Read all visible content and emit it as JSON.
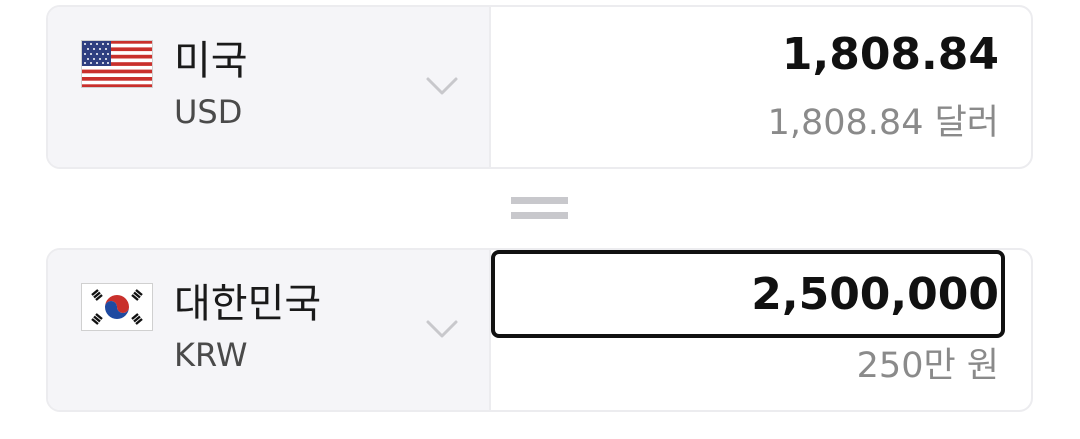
{
  "from": {
    "country": "미국",
    "code": "USD",
    "flag_icon": "us-flag-icon",
    "amount": "1,808.84",
    "amount_text": "1,808.84 달러"
  },
  "equals_icon": "equals-icon",
  "to": {
    "country": "대한민국",
    "code": "KRW",
    "flag_icon": "kr-flag-icon",
    "amount": "2,500,000",
    "amount_text": "250만 원"
  },
  "colors": {
    "panel_bg": "#f5f5f8",
    "border": "#ececef",
    "focus_border": "#111111",
    "muted_text": "#8a8a8a",
    "chevron": "#c8c8cc"
  }
}
